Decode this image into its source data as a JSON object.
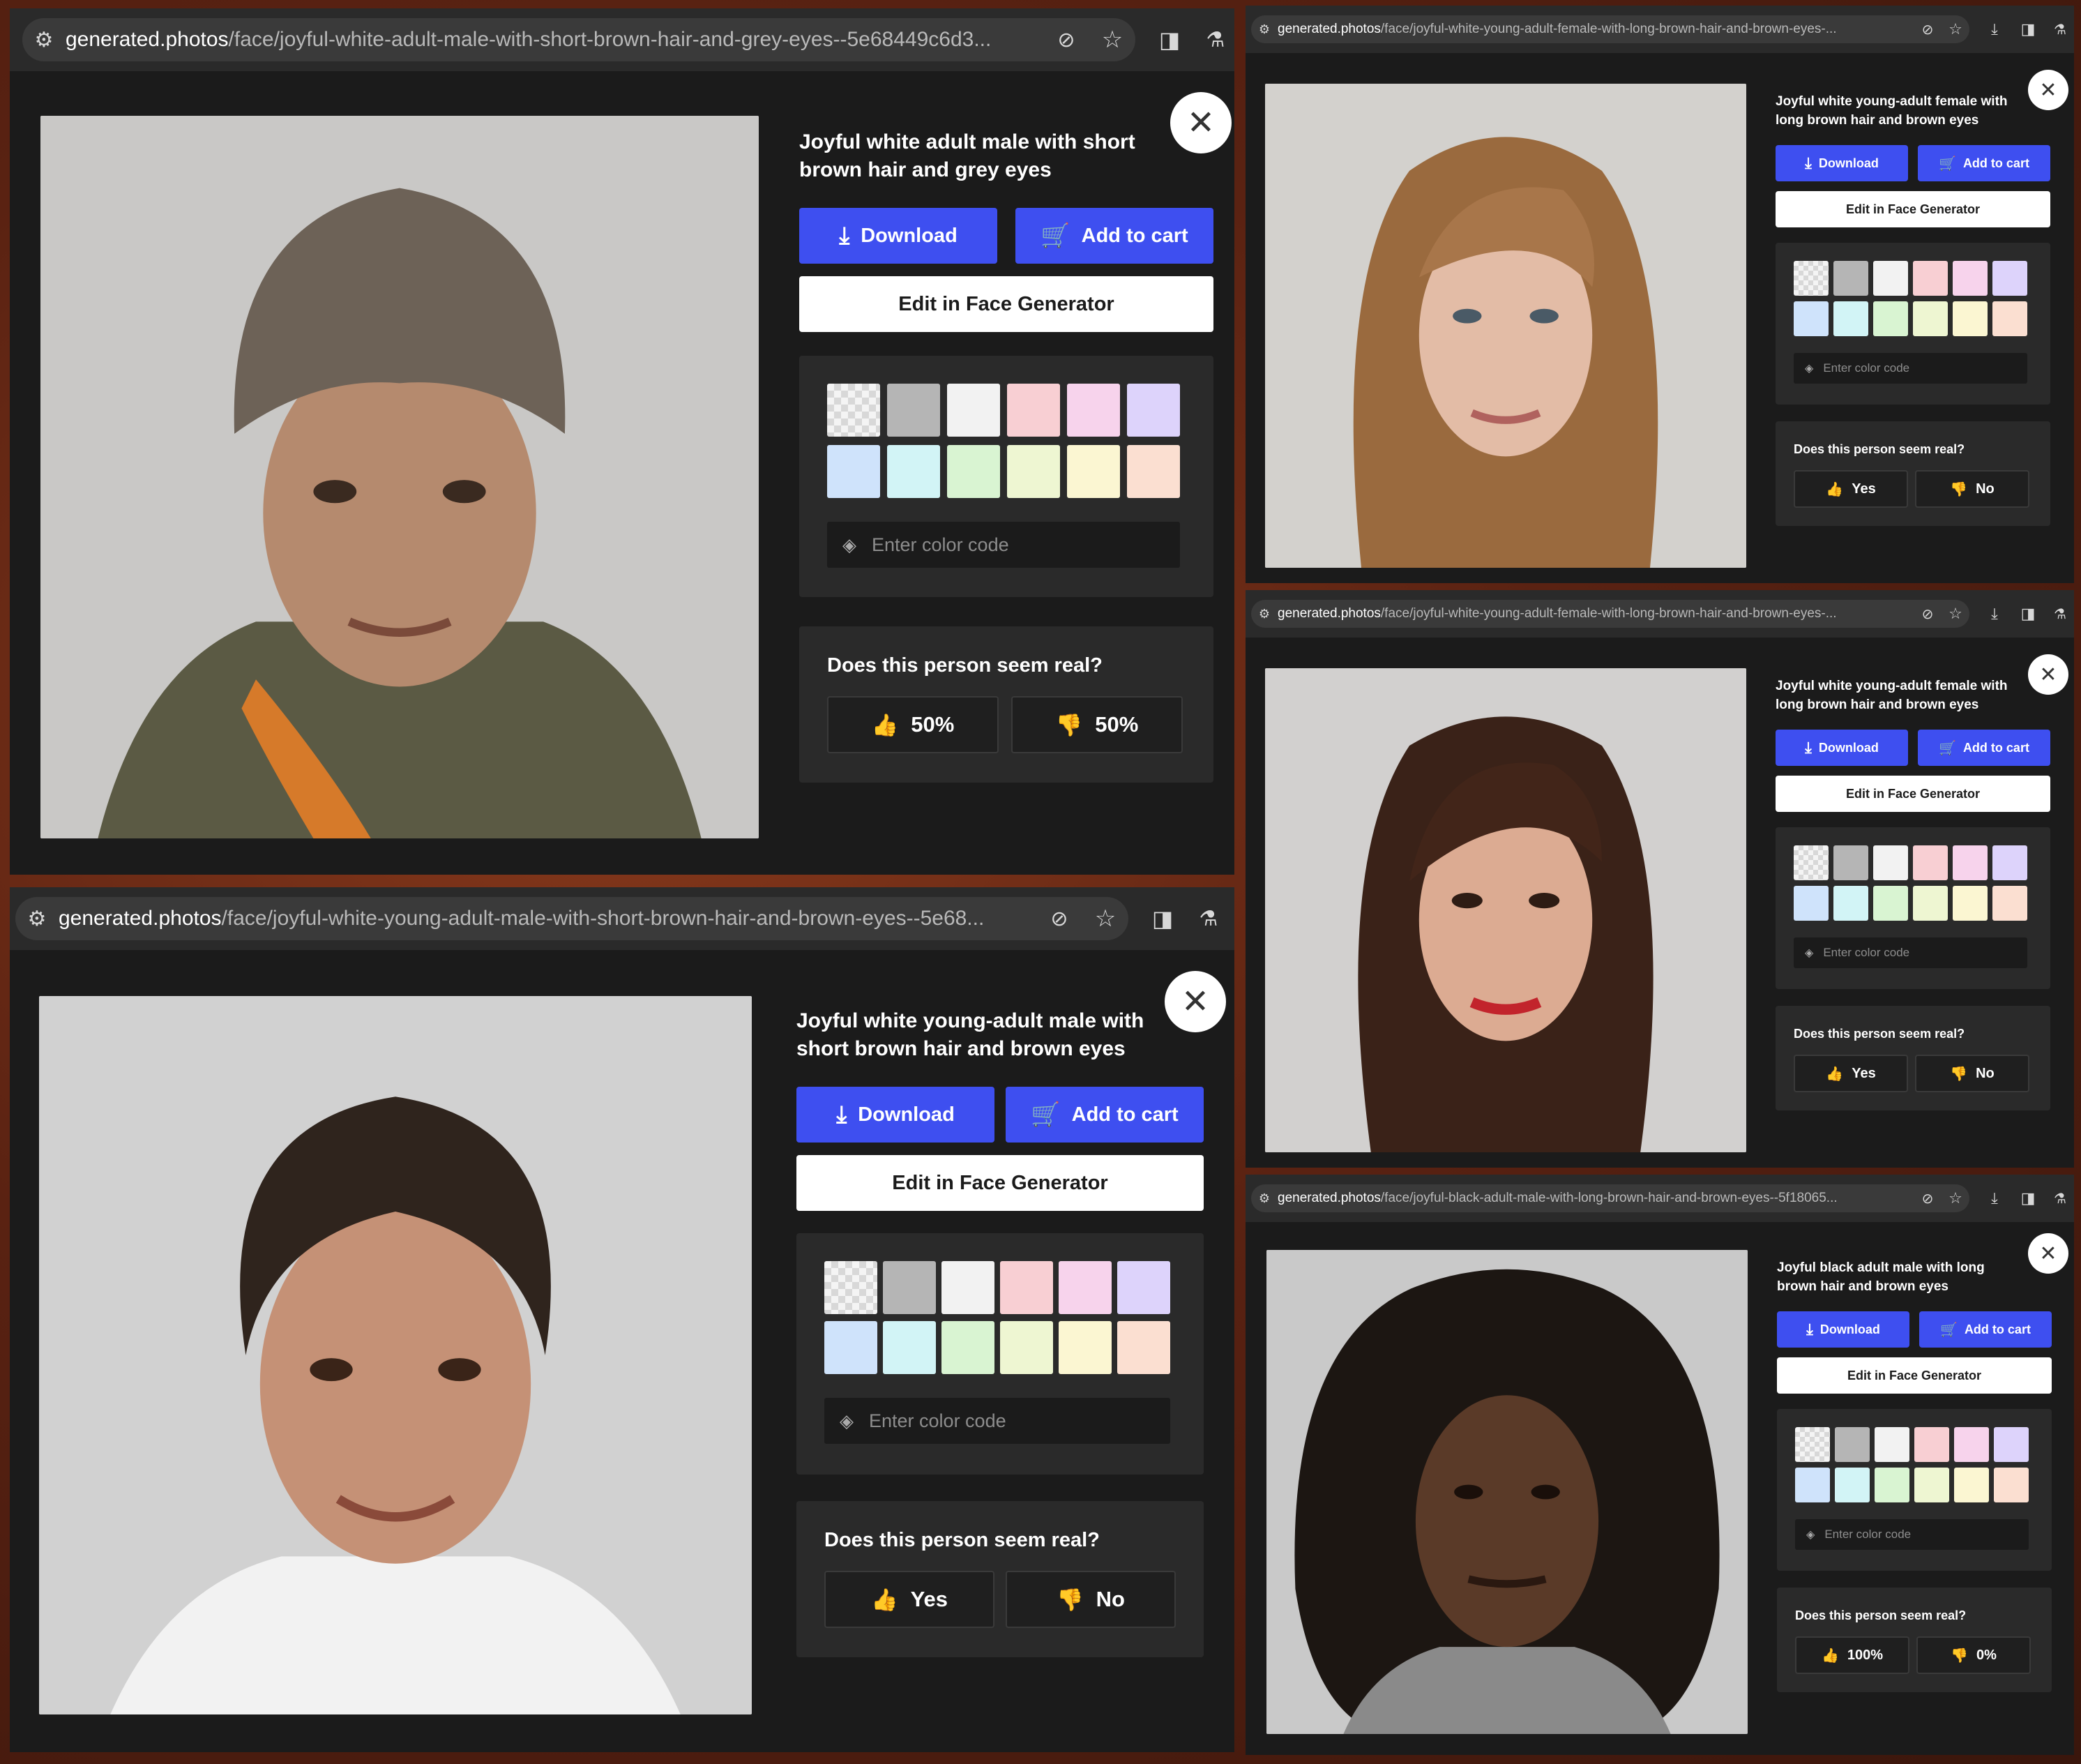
{
  "colors": {
    "accent": "#3e4ff0",
    "panel_bg": "#1b1b1b",
    "box_bg": "#2a2a2a",
    "swatches": [
      "checker",
      "#b5b5b5",
      "#f2f2f2",
      "#f8cfd3",
      "#f7d3ec",
      "#ddd3fb",
      "#cfe3fb",
      "#d2f4f6",
      "#d9f4d2",
      "#eef6d2",
      "#fbf6d2",
      "#fbdfd1"
    ]
  },
  "panels": [
    {
      "url_host": "generated.photos",
      "url_path": "/face/joyful-white-adult-male-with-short-brown-hair-and-grey-eyes--5e68449c6d3...",
      "title": "Joyful white adult male with short brown hair and grey eyes",
      "download_label": "Download",
      "cart_label": "Add to cart",
      "edit_label": "Edit in Face Generator",
      "color_placeholder": "Enter color code",
      "question": "Does this person seem real?",
      "yes_label": "50%",
      "no_label": "50%",
      "photo_icon": "face-photo-older-man-beanie"
    },
    {
      "url_host": "generated.photos",
      "url_path": "/face/joyful-white-young-adult-male-with-short-brown-hair-and-brown-eyes--5e68...",
      "title": "Joyful white young-adult male with short brown hair and brown eyes",
      "download_label": "Download",
      "cart_label": "Add to cart",
      "edit_label": "Edit in Face Generator",
      "color_placeholder": "Enter color code",
      "question": "Does this person seem real?",
      "yes_label": "Yes",
      "no_label": "No",
      "photo_icon": "face-photo-young-man"
    },
    {
      "url_host": "generated.photos",
      "url_path": "/face/joyful-white-young-adult-female-with-long-brown-hair-and-brown-eyes-...",
      "title": "Joyful white young-adult female with long brown hair and brown eyes",
      "download_label": "Download",
      "cart_label": "Add to cart",
      "edit_label": "Edit in Face Generator",
      "color_placeholder": "Enter color code",
      "question": "Does this person seem real?",
      "yes_label": "Yes",
      "no_label": "No",
      "photo_icon": "face-photo-woman-light-brown-hair"
    },
    {
      "url_host": "generated.photos",
      "url_path": "/face/joyful-white-young-adult-female-with-long-brown-hair-and-brown-eyes-...",
      "title": "Joyful white young-adult female with long brown hair and brown eyes",
      "download_label": "Download",
      "cart_label": "Add to cart",
      "edit_label": "Edit in Face Generator",
      "color_placeholder": "Enter color code",
      "question": "Does this person seem real?",
      "yes_label": "Yes",
      "no_label": "No",
      "photo_icon": "face-photo-woman-dark-brown-hair"
    },
    {
      "url_host": "generated.photos",
      "url_path": "/face/joyful-black-adult-male-with-long-brown-hair-and-brown-eyes--5f18065...",
      "title": "Joyful black adult male with long brown hair and brown eyes",
      "download_label": "Download",
      "cart_label": "Add to cart",
      "edit_label": "Edit in Face Generator",
      "color_placeholder": "Enter color code",
      "question": "Does this person seem real?",
      "yes_label": "100%",
      "no_label": "0%",
      "photo_icon": "face-photo-man-curly-hair"
    }
  ]
}
